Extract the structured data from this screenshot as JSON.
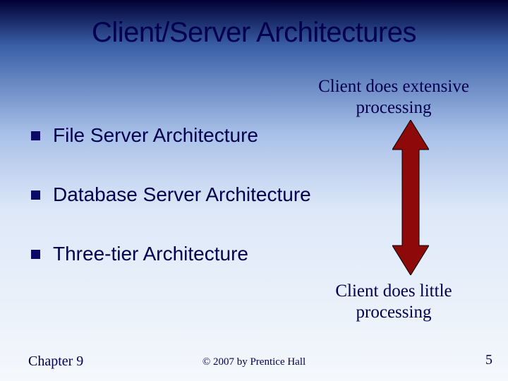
{
  "title": "Client/Server Architectures",
  "bullets": [
    "File Server Architecture",
    "Database Server Architecture",
    "Three-tier Architecture"
  ],
  "label_top": "Client does extensive processing",
  "label_bottom": "Client does little processing",
  "footer": {
    "left": "Chapter 9",
    "center": "© 2007 by Prentice Hall",
    "page": "5"
  },
  "arrow_color": "#8e0a0a"
}
